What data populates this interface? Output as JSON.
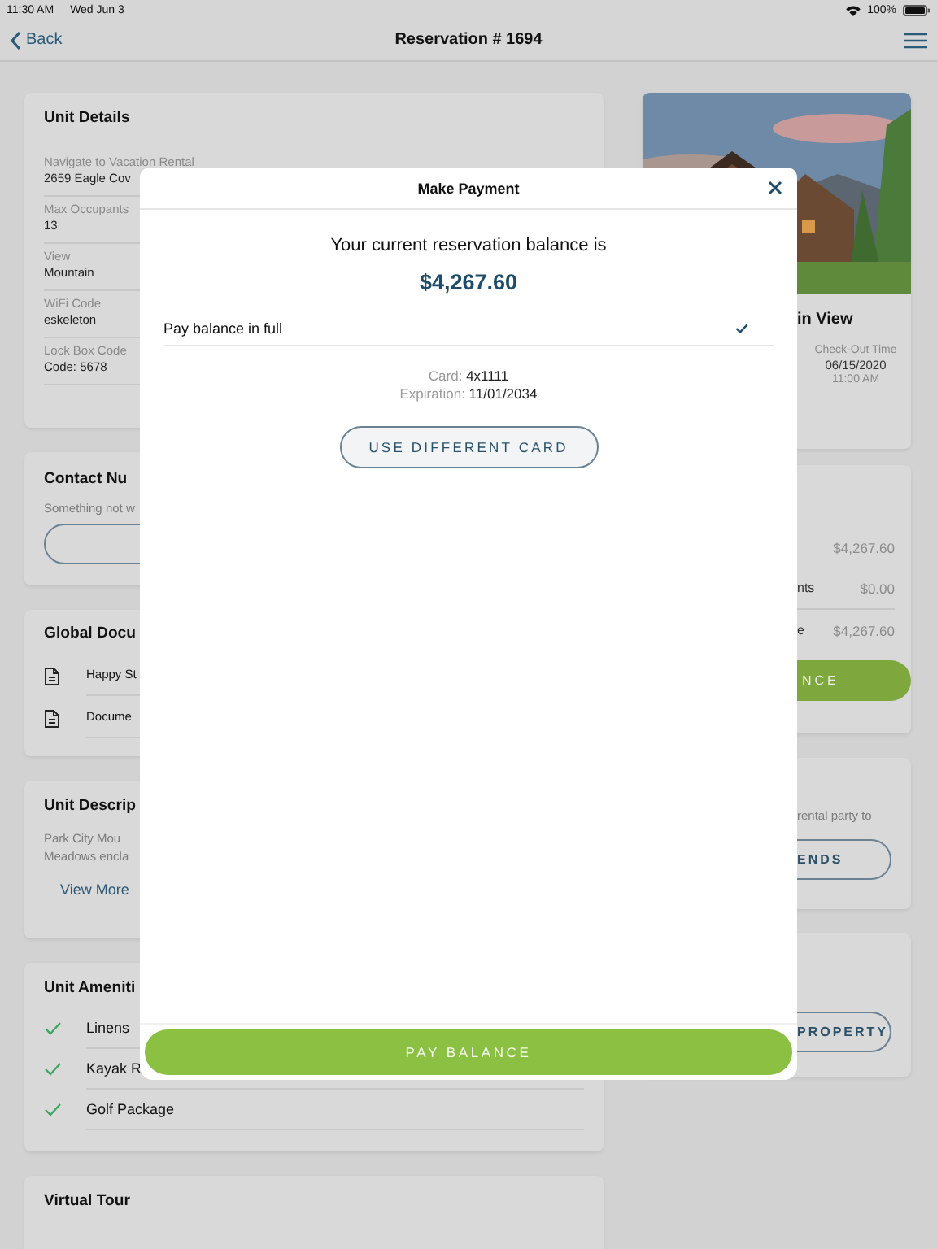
{
  "status_bar": {
    "time": "11:30 AM",
    "date": "Wed Jun 3",
    "battery": "100%"
  },
  "nav": {
    "back": "Back",
    "title": "Reservation # 1694"
  },
  "unit_details": {
    "title": "Unit Details",
    "fields": [
      {
        "label": "Navigate to Vacation Rental",
        "value": "2659 Eagle Cov"
      },
      {
        "label": "Max Occupants",
        "value": "13"
      },
      {
        "label": "View",
        "value": "Mountain"
      },
      {
        "label": "WiFi Code",
        "value": "eskeleton"
      },
      {
        "label": "Lock Box Code",
        "value": "Code: 5678"
      }
    ]
  },
  "contact": {
    "title": "Contact Nu",
    "text": "Something not w"
  },
  "documents": {
    "title": "Global Docu",
    "items": [
      "Happy St",
      "Docume"
    ]
  },
  "description": {
    "title": "Unit Descrip",
    "lines": [
      "Park City Mou",
      "Meadows encla"
    ],
    "link": "View More"
  },
  "amenities": {
    "title": "Unit Ameniti",
    "items": [
      "Linens",
      "Kayak R",
      "Golf Package"
    ]
  },
  "virtual_tour": {
    "title": "Virtual Tour"
  },
  "checkin_card": {
    "title": "in View",
    "checkout_label": "Check-Out Time",
    "checkout_date": "06/15/2020",
    "checkout_time": "11:00 AM"
  },
  "balance_card": {
    "rows": [
      {
        "label": "",
        "value": "$4,267.60"
      },
      {
        "label": "nts",
        "value": "$0.00"
      },
      {
        "label": "e",
        "value": "$4,267.60"
      }
    ],
    "button": "NCE"
  },
  "share_card": {
    "text": "rental party to",
    "button": "ENDS"
  },
  "property_card": {
    "button": "PROPERTY"
  },
  "modal": {
    "title": "Make Payment",
    "prompt": "Your current reservation balance is",
    "amount": "$4,267.60",
    "option": {
      "label": "Pay balance in full",
      "selected": true
    },
    "card_label": "Card:",
    "card_value": "4x1111",
    "exp_label": "Expiration:",
    "exp_value": "11/01/2034",
    "alt_button": "USE DIFFERENT CARD",
    "pay_button": "PAY BALANCE"
  }
}
